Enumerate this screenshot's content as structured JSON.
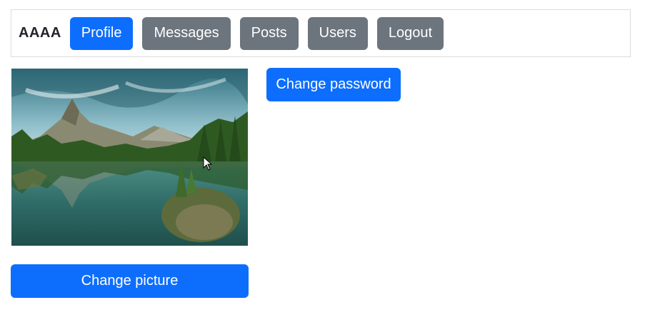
{
  "navbar": {
    "brand": "AAAA",
    "items": [
      {
        "label": "Profile",
        "active": true
      },
      {
        "label": "Messages",
        "active": false
      },
      {
        "label": "Posts",
        "active": false
      },
      {
        "label": "Users",
        "active": false
      },
      {
        "label": "Logout",
        "active": false
      }
    ]
  },
  "profile": {
    "picture_alt": "Mountain lake landscape",
    "change_password_label": "Change password",
    "change_picture_label": "Change picture"
  },
  "colors": {
    "primary": "#0d6efd",
    "secondary": "#6c757d"
  }
}
